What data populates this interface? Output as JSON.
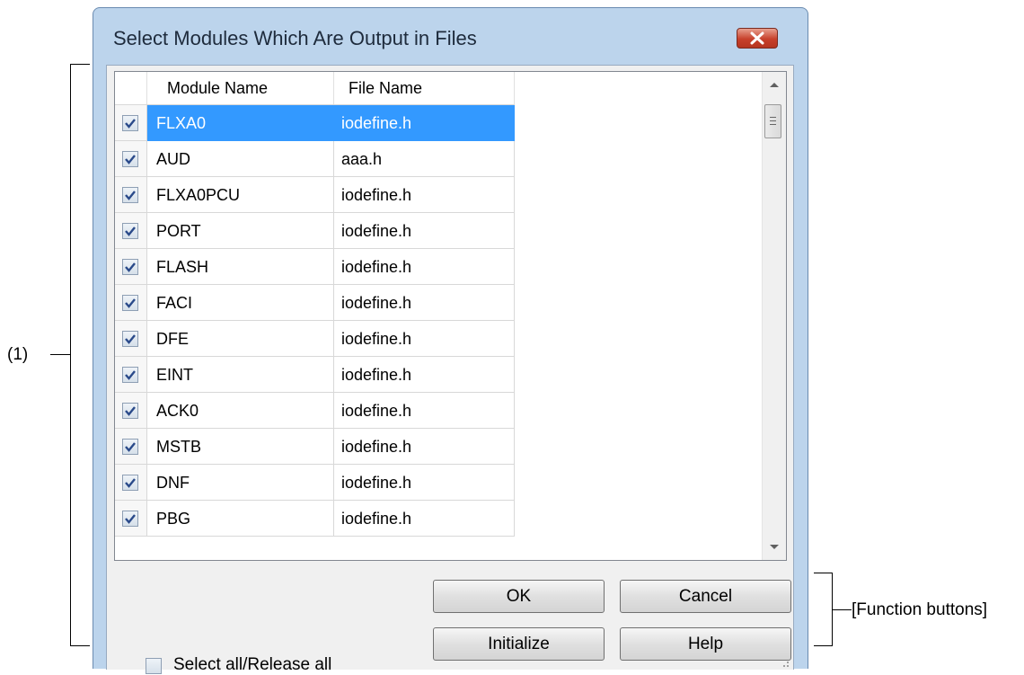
{
  "annotations": {
    "left_label": "(1)",
    "right_label": "[Function buttons]"
  },
  "dialog": {
    "title": "Select Modules Which Are Output in Files",
    "close_icon": "close-icon"
  },
  "grid": {
    "columns": [
      "Module Name",
      "File Name"
    ],
    "rows": [
      {
        "checked": true,
        "module": "FLXA0",
        "file": "iodefine.h",
        "selected": true
      },
      {
        "checked": true,
        "module": "AUD",
        "file": "aaa.h"
      },
      {
        "checked": true,
        "module": "FLXA0PCU",
        "file": "iodefine.h"
      },
      {
        "checked": true,
        "module": "PORT",
        "file": "iodefine.h"
      },
      {
        "checked": true,
        "module": "FLASH",
        "file": "iodefine.h"
      },
      {
        "checked": true,
        "module": "FACI",
        "file": "iodefine.h"
      },
      {
        "checked": true,
        "module": "DFE",
        "file": "iodefine.h"
      },
      {
        "checked": true,
        "module": "EINT",
        "file": "iodefine.h"
      },
      {
        "checked": true,
        "module": "ACK0",
        "file": "iodefine.h"
      },
      {
        "checked": true,
        "module": "MSTB",
        "file": "iodefine.h"
      },
      {
        "checked": true,
        "module": "DNF",
        "file": "iodefine.h"
      },
      {
        "checked": true,
        "module": "PBG",
        "file": "iodefine.h"
      }
    ]
  },
  "footer": {
    "select_all_label": "Select all/Release all",
    "select_all_checked": false,
    "ok_label": "OK",
    "cancel_label": "Cancel",
    "initialize_label": "Initialize",
    "help_label": "Help"
  },
  "colors": {
    "selection": "#3399ff",
    "close_button": "#c7402b",
    "frame": "#bcd4ec"
  }
}
